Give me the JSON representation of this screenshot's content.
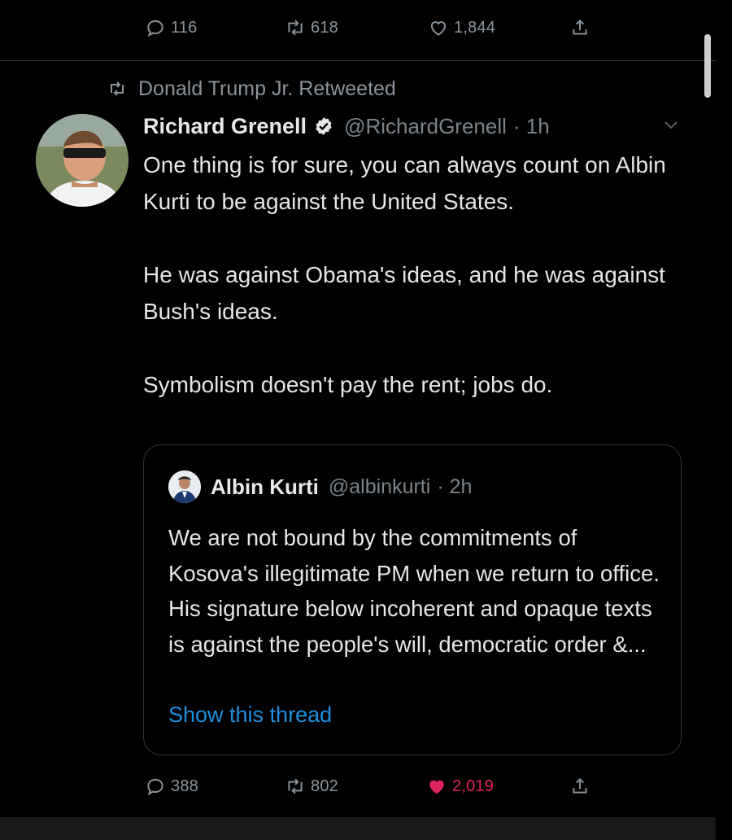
{
  "previous_tweet_actions": {
    "reply_count": "116",
    "retweet_count": "618",
    "like_count": "1,844"
  },
  "retweet_context": {
    "label": "Donald Trump Jr. Retweeted"
  },
  "tweet": {
    "author_name": "Richard Grenell",
    "author_handle": "@RichardGrenell",
    "time": "· 1h",
    "paragraphs": [
      "One thing is for sure, you can always count on Albin Kurti to be against the United States.",
      "He was against Obama's ideas, and he was against Bush's ideas.",
      "Symbolism doesn't pay the rent; jobs do."
    ],
    "reply_count": "388",
    "retweet_count": "802",
    "like_count": "2,019",
    "liked": true
  },
  "quoted_tweet": {
    "author_name": "Albin Kurti",
    "author_handle": "@albinkurti",
    "time": "· 2h",
    "text": "We are not bound by the commitments of Kosova's illegitimate PM when we return to office. His signature below incoherent and opaque texts is against the people's will, democratic order &...",
    "show_thread_label": "Show this thread"
  },
  "colors": {
    "background": "#000000",
    "text": "#e6e6e6",
    "secondary": "#7b848b",
    "link": "#1d8fdf",
    "like_active": "#e0245e",
    "border": "#2f3336"
  },
  "icons": {
    "reply": "reply-icon",
    "retweet": "retweet-icon",
    "like": "heart-icon",
    "share": "share-icon",
    "verified": "verified-badge-icon",
    "more": "chevron-down-icon"
  }
}
